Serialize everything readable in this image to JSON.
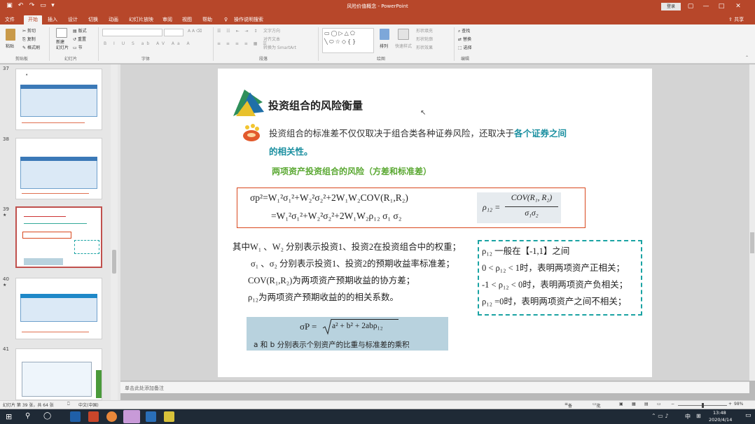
{
  "window": {
    "title": "风险价值概念 - PowerPoint",
    "signin": "登录",
    "share": "共享"
  },
  "tabs": [
    "文件",
    "开始",
    "插入",
    "设计",
    "切换",
    "动画",
    "幻灯片放映",
    "审阅",
    "视图",
    "帮助"
  ],
  "tell_me": "操作说明搜索",
  "ribbon": {
    "paste": "粘贴",
    "cut": "剪切",
    "copy": "复制",
    "format_painter": "格式刷",
    "new_slide": "新建\n幻灯片",
    "layout": "版式",
    "reset": "重置",
    "section": "节",
    "text_direction": "文字方向",
    "align_text": "对齐文本",
    "convert_smartart": "转换为 SmartArt",
    "arrange": "排列",
    "quick_styles": "快速样式",
    "shape_fill": "形状填充",
    "shape_outline": "形状轮廓",
    "shape_effects": "形状效果",
    "find": "查找",
    "replace": "替换",
    "select": "选择",
    "groups": {
      "clipboard": "剪贴板",
      "slides": "幻灯片",
      "font": "字体",
      "paragraph": "段落",
      "drawing": "绘图",
      "editing": "编辑"
    }
  },
  "thumbnails": [
    {
      "num": "37",
      "star": ""
    },
    {
      "num": "38",
      "star": ""
    },
    {
      "num": "39",
      "star": "★"
    },
    {
      "num": "40",
      "star": "★"
    },
    {
      "num": "41",
      "star": ""
    }
  ],
  "slide": {
    "title": "投资组合的风险衡量",
    "intro1": "投资组合的标准差不仅仅取决于组合类各种证券风险，还取决于",
    "intro_highlight": "各个证券之间",
    "intro2": "的相关性。",
    "subtitle": "两项资产投资组合的风险（方差和标准差）",
    "formula_left_1": "σp²=W₁²σ₁²+W₂²σ₂²+2W₁W₂COV(R₁,R₂)",
    "formula_left_2": "=W₁²σ₁²+W₂²σ₂²+2W₁W₂ρ₁₂ σ₁ σ₂",
    "rho_label": "ρ₁₂ =",
    "rho_num": "COV(R₁, R₂)",
    "rho_den": "σ₁σ₂",
    "where1": "其中W₁ 、W₂ 分别表示投资1、投资2在投资组合中的权重；",
    "where2": "σ₁ 、σ₂ 分别表示投资1、投资2的预期收益率标准差；",
    "where3": "COV(R₁,R₂)为两项资产预期收益的协方差；",
    "where4": "ρ₁₂为两项资产预期收益的的相关系数。",
    "box_line1": "ρ₁₂ 一般在【-1,1】之间",
    "box_line2": "0 < ρ₁₂   < 1时，表明两项资产正相关；",
    "box_line3": "-1 < ρ₁₂   < 0时，表明两项资产负相关；",
    "box_line4": "ρ₁₂   =0时，表明两项资产之间不相关；",
    "bottom_formula_lhs": "σP =",
    "bottom_formula_rad": "a² + b² + 2abρ₁₂",
    "bottom_note": "a 和 b 分别表示个别资产的比重与标准差的乘积"
  },
  "notes_placeholder": "单击此处添加备注",
  "status": {
    "slide_info": "幻灯片 第 39 张，共 64 张",
    "language": "中文(中国)",
    "notes": "备注",
    "comments": "批注",
    "zoom": "98%"
  },
  "taskbar": {
    "time": "13:48",
    "date": "2020/4/14",
    "ime": "中"
  },
  "colors": {
    "accent": "#b7472a",
    "teal_text": "#1a8fa0",
    "green_text": "#5aa832",
    "formula_border": "#d9481e",
    "dashed_border": "#1aa3a3",
    "formula_bg": "#b8d2de"
  }
}
